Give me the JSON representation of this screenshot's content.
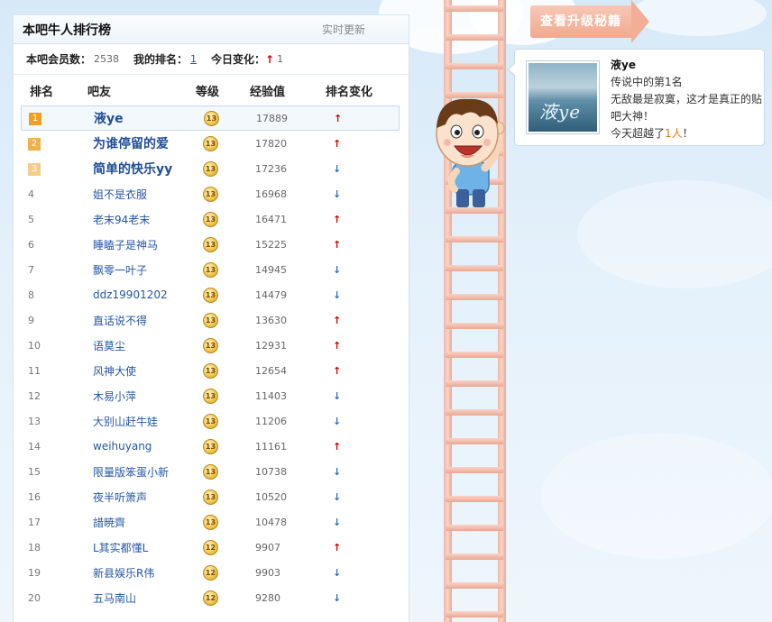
{
  "panel": {
    "title": "本吧牛人排行榜",
    "realtime": "实时更新"
  },
  "stats": {
    "members_label": "本吧会员数：",
    "members_value": "2538",
    "my_rank_label": "我的排名：",
    "my_rank_value": "1",
    "today_label": "今日变化：",
    "today_arrow": "↑",
    "today_value": "1"
  },
  "columns": {
    "rank": "排名",
    "name": "吧友",
    "level": "等级",
    "exp": "经验值",
    "change": "排名变化"
  },
  "rows": [
    {
      "rank": "1",
      "name": "液ye",
      "level": "13",
      "exp": "17889",
      "change": "up"
    },
    {
      "rank": "2",
      "name": "为谁停留的爱",
      "level": "13",
      "exp": "17820",
      "change": "up"
    },
    {
      "rank": "3",
      "name": "简单的快乐yy",
      "level": "13",
      "exp": "17236",
      "change": "down"
    },
    {
      "rank": "4",
      "name": "姐不是衣服",
      "level": "13",
      "exp": "16968",
      "change": "down"
    },
    {
      "rank": "5",
      "name": "老末94老末",
      "level": "13",
      "exp": "16471",
      "change": "up"
    },
    {
      "rank": "6",
      "name": "睡瞌子是神马",
      "level": "13",
      "exp": "15225",
      "change": "up"
    },
    {
      "rank": "7",
      "name": "飘零一叶子",
      "level": "13",
      "exp": "14945",
      "change": "down"
    },
    {
      "rank": "8",
      "name": "ddz19901202",
      "level": "13",
      "exp": "14479",
      "change": "down"
    },
    {
      "rank": "9",
      "name": "直话说不得",
      "level": "13",
      "exp": "13630",
      "change": "up"
    },
    {
      "rank": "10",
      "name": "语莫尘",
      "level": "13",
      "exp": "12931",
      "change": "up"
    },
    {
      "rank": "11",
      "name": "风神大使",
      "level": "13",
      "exp": "12654",
      "change": "up"
    },
    {
      "rank": "12",
      "name": "木易小萍",
      "level": "13",
      "exp": "11403",
      "change": "down"
    },
    {
      "rank": "13",
      "name": "大别山赶牛娃",
      "level": "13",
      "exp": "11206",
      "change": "down"
    },
    {
      "rank": "14",
      "name": "weihuyang",
      "level": "13",
      "exp": "11161",
      "change": "up"
    },
    {
      "rank": "15",
      "name": "限量版笨蛋小新",
      "level": "13",
      "exp": "10738",
      "change": "down"
    },
    {
      "rank": "16",
      "name": "夜半听箫声",
      "level": "13",
      "exp": "10520",
      "change": "down"
    },
    {
      "rank": "17",
      "name": "諎暁齊",
      "level": "13",
      "exp": "10478",
      "change": "down"
    },
    {
      "rank": "18",
      "name": "L其实都懂L",
      "level": "12",
      "exp": "9907",
      "change": "up"
    },
    {
      "rank": "19",
      "name": "新县娱乐R伟",
      "level": "12",
      "exp": "9903",
      "change": "down"
    },
    {
      "rank": "20",
      "name": "五马南山",
      "level": "12",
      "exp": "9280",
      "change": "down"
    }
  ],
  "arrows": {
    "up": "↑",
    "down": "↓"
  },
  "upgrade": {
    "label": "查看升级秘籍"
  },
  "top_card": {
    "name": "液ye",
    "line1": "传说中的第1名",
    "line2": "无敌最是寂寞，这才是真正的贴吧大神！",
    "line3_prefix": "今天超越了",
    "line3_count": "1人",
    "line3_suffix": "！",
    "avatar_text": "液ye"
  },
  "colors": {
    "accent": "#2656a6",
    "up": "#d20000",
    "down": "#2f6fb8",
    "ladder": "#f0b8a6"
  }
}
